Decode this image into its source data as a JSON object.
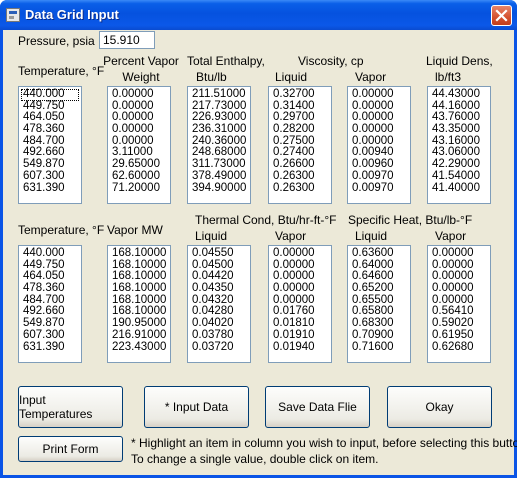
{
  "window": {
    "title": "Data Grid Input"
  },
  "pressure": {
    "label": "Pressure, psia",
    "value": "15.910"
  },
  "grid1": {
    "col_temperature": "Temperature, °F",
    "col_percent_vapor_1": "Percent Vapor",
    "col_percent_vapor_2": "Weight",
    "col_enthalpy_1": "Total Enthalpy,",
    "col_enthalpy_2": "Btu/lb",
    "col_viscosity": "Viscosity, cp",
    "col_liquid": "Liquid",
    "col_vapor": "Vapor",
    "col_liqdens_1": "Liquid Dens,",
    "col_liqdens_2": "lb/ft3",
    "temperature": [
      "440.000",
      "449.750",
      "464.050",
      "478.360",
      "484.700",
      "492.660",
      "549.870",
      "607.300",
      "631.390"
    ],
    "percent_vapor": [
      "0.00000",
      "0.00000",
      "0.00000",
      "0.00000",
      "0.00000",
      "3.11000",
      "29.65000",
      "62.60000",
      "71.20000"
    ],
    "enthalpy": [
      "211.51000",
      "217.73000",
      "226.93000",
      "236.31000",
      "240.36000",
      "248.68000",
      "311.73000",
      "378.49000",
      "394.90000"
    ],
    "visc_liquid": [
      "0.32700",
      "0.31400",
      "0.29700",
      "0.28200",
      "0.27500",
      "0.27400",
      "0.26600",
      "0.26300",
      "0.26300"
    ],
    "visc_vapor": [
      "0.00000",
      "0.00000",
      "0.00000",
      "0.00000",
      "0.00000",
      "0.00940",
      "0.00960",
      "0.00970",
      "0.00970"
    ],
    "liq_dens": [
      "44.43000",
      "44.16000",
      "43.76000",
      "43.35000",
      "43.16000",
      "43.06000",
      "42.29000",
      "41.54000",
      "41.40000"
    ]
  },
  "grid2": {
    "col_temperature": "Temperature, °F",
    "col_vapor_mw": "Vapor MW",
    "col_thermcond": "Thermal Cond, Btu/hr-ft-°F",
    "col_specheat": "Specific Heat, Btu/lb-°F",
    "col_liquid": "Liquid",
    "col_vapor": "Vapor",
    "temperature": [
      "440.000",
      "449.750",
      "464.050",
      "478.360",
      "484.700",
      "492.660",
      "549.870",
      "607.300",
      "631.390"
    ],
    "vapor_mw": [
      "168.10000",
      "168.10000",
      "168.10000",
      "168.10000",
      "168.10000",
      "168.10000",
      "190.95000",
      "216.91000",
      "223.43000"
    ],
    "tc_liquid": [
      "0.04550",
      "0.04500",
      "0.04420",
      "0.04350",
      "0.04320",
      "0.04280",
      "0.04020",
      "0.03780",
      "0.03720"
    ],
    "tc_vapor": [
      "0.00000",
      "0.00000",
      "0.00000",
      "0.00000",
      "0.00000",
      "0.01760",
      "0.01810",
      "0.01910",
      "0.01940"
    ],
    "sh_liquid": [
      "0.63600",
      "0.64000",
      "0.64600",
      "0.65200",
      "0.65500",
      "0.65800",
      "0.68300",
      "0.70900",
      "0.71600"
    ],
    "sh_vapor": [
      "0.00000",
      "0.00000",
      "0.00000",
      "0.00000",
      "0.00000",
      "0.56410",
      "0.59020",
      "0.61950",
      "0.62680"
    ]
  },
  "buttons": {
    "input_temperatures": "Input Temperatures",
    "input_data": "* Input Data",
    "save_data_file": "Save Data Flie",
    "okay": "Okay",
    "print_form": "Print Form"
  },
  "note": {
    "line1": "* Highlight an item in column you wish to input, before selecting this button.",
    "line2": "To change a single value, double click on item."
  },
  "icons": {
    "app": "form-icon",
    "close": "close-icon"
  }
}
